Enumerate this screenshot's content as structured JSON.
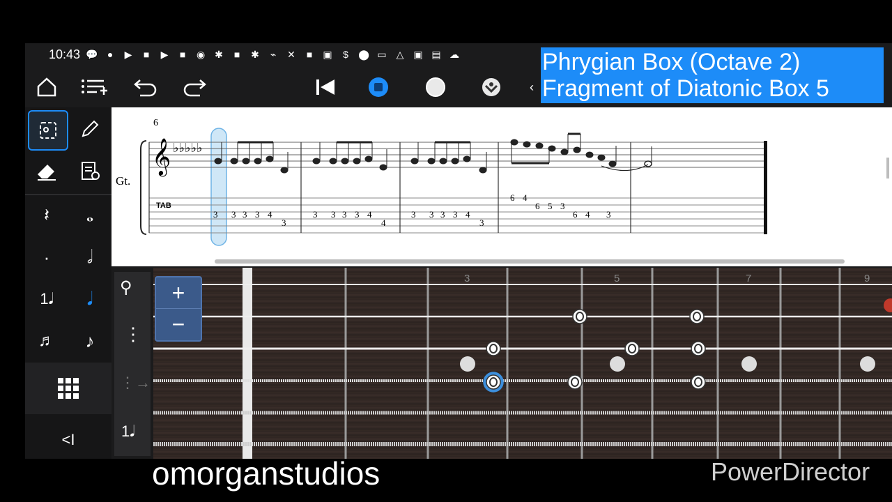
{
  "status": {
    "time": "10:43"
  },
  "overlay": {
    "line1": "Phrygian Box (Octave 2)",
    "line2": "Fragment of Diatonic Box 5"
  },
  "score": {
    "measure_number": "6",
    "track_label": "Gt.",
    "tab_label": "TAB",
    "tab_numbers": [
      [
        "3",
        "3",
        "3",
        "3",
        "4",
        "3"
      ],
      [
        "3",
        "3",
        "3",
        "3",
        "4",
        "4"
      ],
      [
        "3",
        "3",
        "3",
        "3",
        "4",
        "3"
      ],
      [
        "6",
        "4",
        "6",
        "5",
        "3",
        "6",
        "4",
        "3"
      ]
    ]
  },
  "fretboard": {
    "fret_numbers": [
      "3",
      "5",
      "7",
      "9"
    ]
  },
  "zoom": {
    "plus": "+",
    "minus": "−"
  },
  "sidebar": {
    "collapse_label": "<I"
  },
  "watermarks": {
    "left": "omorganstudios",
    "right": "PowerDirector"
  },
  "colors": {
    "accent": "#1d8cf8",
    "selection": "#cfe7f7"
  },
  "icons": [
    "home-icon",
    "add-track-icon",
    "undo-icon",
    "redo-icon",
    "rewind-icon",
    "stop-icon",
    "record-icon",
    "metronome-icon",
    "select-icon",
    "pencil-icon",
    "eraser-icon",
    "properties-icon",
    "rest-icon",
    "whole-note-icon",
    "dot-icon",
    "half-note-icon",
    "tuplet-icon",
    "quarter-note-icon",
    "triplet-icon",
    "eighth-note-icon",
    "grid-icon"
  ]
}
